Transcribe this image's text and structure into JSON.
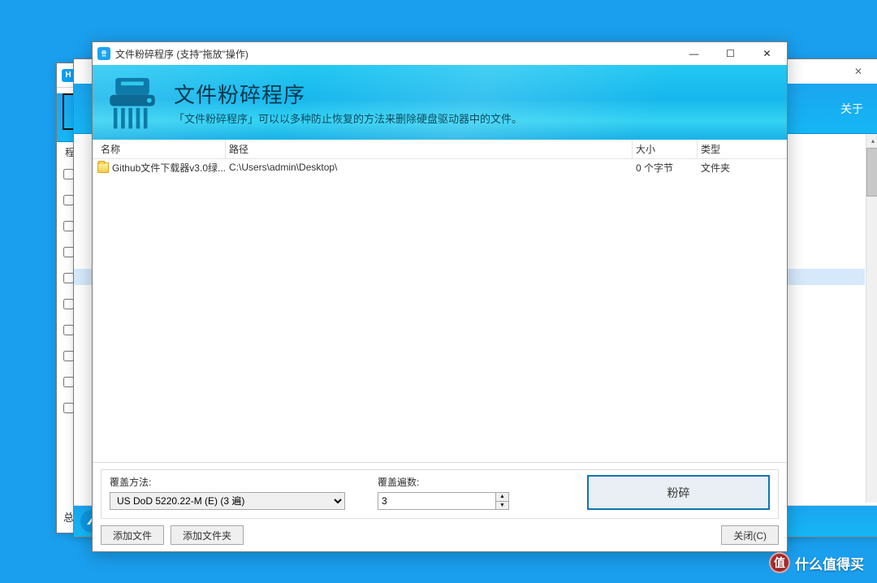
{
  "bgWin": {
    "title": "Hi",
    "listHeader": "程序名",
    "totals": "总计:",
    "rows": [
      {
        "color": "#2a8ff0"
      },
      {
        "color": "#1a78e8"
      },
      {
        "color": "linear-gradient(135deg,#ea4335 0 25%,#fbbc05 25% 50%,#34a853 50% 75%,#4285f4 75%)"
      },
      {
        "color": "#1877f2"
      },
      {
        "color": "radial-gradient(circle,#ff6ac1,#b84af9,#6c3cf1)"
      },
      {
        "color": "#6aa0d8"
      },
      {
        "color": "#6aa0d8"
      },
      {
        "color": "#6aa0d8"
      },
      {
        "color": "#6aa0d8"
      },
      {
        "color": "#d8b05a"
      }
    ]
  },
  "midWin": {
    "aboutTab": "关于",
    "closeGlyph": "✕",
    "upGlyph": "▴",
    "dnGlyph": "▾"
  },
  "win": {
    "title": "文件粉碎程序 (支持\"拖放\"操作)",
    "banner": {
      "h1": "文件粉碎程序",
      "sub": "「文件粉碎程序」可以以多种防止恢复的方法来删除硬盘驱动器中的文件。"
    },
    "minGlyph": "—",
    "maxGlyph": "☐",
    "closeGlyph": "✕",
    "columns": {
      "name": "名称",
      "path": "路径",
      "size": "大小",
      "type": "类型"
    },
    "rows": [
      {
        "name": "Github文件下载器v3.0绿...",
        "path": "C:\\Users\\admin\\Desktop\\",
        "size": "0 个字节",
        "type": "文件夹"
      }
    ],
    "method": {
      "label": "覆盖方法:",
      "value": "US DoD 5220.22-M (E) (3 遍)"
    },
    "passes": {
      "label": "覆盖遍数:",
      "value": "3",
      "upGlyph": "▲",
      "dnGlyph": "▼"
    },
    "shredBtn": "粉碎",
    "addFile": "添加文件",
    "addFolder": "添加文件夹",
    "closeBtn": "关闭(C)"
  },
  "watermark": {
    "logo": "值",
    "text": "什么值得买"
  }
}
